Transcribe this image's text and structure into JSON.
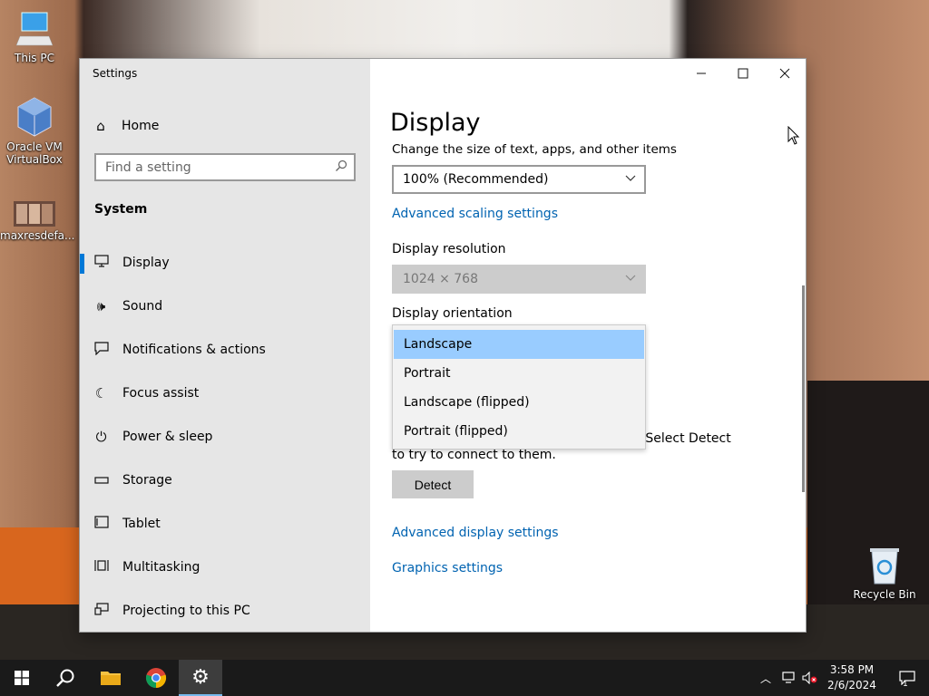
{
  "desktop": {
    "icons": [
      {
        "label": "This PC",
        "icon": "computer-icon"
      },
      {
        "label": "Oracle VM VirtualBox",
        "icon": "virtualbox-icon"
      },
      {
        "label": "maxresdefa...",
        "icon": "image-file-icon"
      },
      {
        "label": "Recycle Bin",
        "icon": "recycle-bin-icon"
      }
    ]
  },
  "window": {
    "title": "Settings",
    "controls": {
      "minimize": "—",
      "maximize": "☐",
      "close": "✕"
    }
  },
  "sidebar": {
    "home_label": "Home",
    "search_placeholder": "Find a setting",
    "section_label": "System",
    "items": [
      {
        "label": "Display",
        "icon": "monitor-icon",
        "active": true
      },
      {
        "label": "Sound",
        "icon": "speaker-icon"
      },
      {
        "label": "Notifications & actions",
        "icon": "notification-icon"
      },
      {
        "label": "Focus assist",
        "icon": "moon-icon"
      },
      {
        "label": "Power & sleep",
        "icon": "power-icon"
      },
      {
        "label": "Storage",
        "icon": "storage-icon"
      },
      {
        "label": "Tablet",
        "icon": "tablet-icon"
      },
      {
        "label": "Multitasking",
        "icon": "multitasking-icon"
      },
      {
        "label": "Projecting to this PC",
        "icon": "projecting-icon"
      }
    ]
  },
  "content": {
    "page_title": "Display",
    "scale_label": "Change the size of text, apps, and other items",
    "scale_value": "100% (Recommended)",
    "advanced_scaling_link": "Advanced scaling settings",
    "resolution_label": "Display resolution",
    "resolution_value": "1024 × 768",
    "orientation_label": "Display orientation",
    "orientation_options": [
      "Landscape",
      "Portrait",
      "Landscape (flipped)",
      "Portrait (flipped)"
    ],
    "orientation_selected": "Landscape",
    "detect_text_1": "omatically. Select Detect",
    "detect_text_2": "to try to connect to them.",
    "detect_button": "Detect",
    "advanced_display_link": "Advanced display settings",
    "graphics_link": "Graphics settings"
  },
  "taskbar": {
    "time": "3:58 PM",
    "date": "2/6/2024",
    "notification_count": "1"
  },
  "colors": {
    "accent": "#0078d7",
    "link": "#0063b1",
    "selected_option": "#99ccff"
  }
}
